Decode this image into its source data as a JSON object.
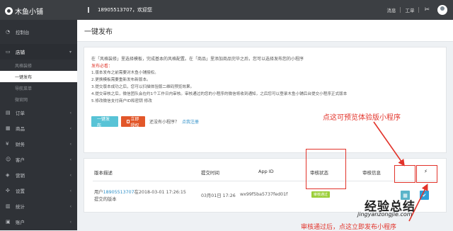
{
  "topbar": {
    "brand": "木鱼小铺",
    "welcome": "18905513707，欢迎您",
    "links": [
      "消息",
      "工单"
    ],
    "tool_icon": "settings-tools-icon"
  },
  "sidebar": {
    "dashboard": "控制台",
    "shop": "店铺",
    "sub_items": [
      "风格装修",
      "一键发布",
      "导航菜单",
      "微官网"
    ],
    "items": [
      "订单",
      "商品",
      "财务",
      "客户",
      "营销",
      "设置",
      "统计",
      "账户"
    ]
  },
  "page": {
    "title": "一键发布",
    "intro": "在「风格装修」里选择模板，完成基本的风格配置。在「商品」里添加商品完毕之后，您可以选择发布您的小程序",
    "notice_title": "发布必看：",
    "notice_lines": [
      "1.版本发布之前需要对木鱼小铺授权。",
      "2.更换模板需要重新发布新版本。",
      "3.提交版本成功之后，您可以扫描体验版二维码预览效果。",
      "4.提交审核之后，微信团队会在约1个工作日内审核。审核通过的您的小程序的微信将收到通知，之后您可以登录木鱼小铺后台提交小程序正式版本",
      "5.修改微信支付商户ID和密钥 修改"
    ],
    "btn_publish": "一键发布",
    "btn_authorize": "立即授权",
    "has_mini": "还没有小程序？",
    "register_link": "点我注册"
  },
  "table": {
    "headers": [
      "版本描述",
      "提交时间",
      "App ID",
      "审核状态",
      "审核信息",
      "⚡"
    ],
    "row": {
      "desc_prefix": "用户",
      "desc_phone": "18905513707",
      "desc_suffix": "在2018-03-01 17:26:15",
      "desc_line2": "提交的版本",
      "time": "03月01日 17:26",
      "app_id": "wx99f5ba5737fed01f",
      "status": "审核通过"
    }
  },
  "annotations": {
    "preview": "点这可预览体验版小程序",
    "release": "审核通过后，点这立即发布小程序"
  },
  "watermark": {
    "text": "经验总结",
    "url": "jingyanzongjie.com"
  },
  "colors": {
    "accent_blue": "#58c3d6",
    "accent_red": "#e2572a",
    "annotation_red": "#e2332a",
    "status_green": "#9bcf3a"
  }
}
